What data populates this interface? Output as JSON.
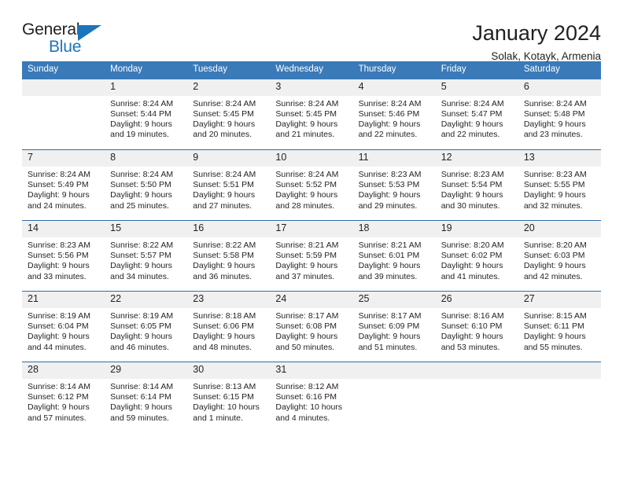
{
  "brand": {
    "name_dark": "General",
    "name_blue": "Blue",
    "triangle_icon": "blue-triangle-logo-mark",
    "accent_color": "#1b75bb"
  },
  "header": {
    "title": "January 2024",
    "subtitle": "Solak, Kotayk, Armenia"
  },
  "theme": {
    "header_row_background": "#3a7ab8",
    "header_row_text": "#ffffff",
    "daynum_background": "#f0f0f0",
    "row_divider": "#2f6ea8",
    "body_text": "#231f20"
  },
  "weekdays": [
    "Sunday",
    "Monday",
    "Tuesday",
    "Wednesday",
    "Thursday",
    "Friday",
    "Saturday"
  ],
  "weeks": [
    [
      {
        "day": "",
        "sunrise": "",
        "sunset": "",
        "daylight_1": "",
        "daylight_2": "",
        "empty": true
      },
      {
        "day": "1",
        "sunrise": "Sunrise: 8:24 AM",
        "sunset": "Sunset: 5:44 PM",
        "daylight_1": "Daylight: 9 hours",
        "daylight_2": "and 19 minutes."
      },
      {
        "day": "2",
        "sunrise": "Sunrise: 8:24 AM",
        "sunset": "Sunset: 5:45 PM",
        "daylight_1": "Daylight: 9 hours",
        "daylight_2": "and 20 minutes."
      },
      {
        "day": "3",
        "sunrise": "Sunrise: 8:24 AM",
        "sunset": "Sunset: 5:45 PM",
        "daylight_1": "Daylight: 9 hours",
        "daylight_2": "and 21 minutes."
      },
      {
        "day": "4",
        "sunrise": "Sunrise: 8:24 AM",
        "sunset": "Sunset: 5:46 PM",
        "daylight_1": "Daylight: 9 hours",
        "daylight_2": "and 22 minutes."
      },
      {
        "day": "5",
        "sunrise": "Sunrise: 8:24 AM",
        "sunset": "Sunset: 5:47 PM",
        "daylight_1": "Daylight: 9 hours",
        "daylight_2": "and 22 minutes."
      },
      {
        "day": "6",
        "sunrise": "Sunrise: 8:24 AM",
        "sunset": "Sunset: 5:48 PM",
        "daylight_1": "Daylight: 9 hours",
        "daylight_2": "and 23 minutes."
      }
    ],
    [
      {
        "day": "7",
        "sunrise": "Sunrise: 8:24 AM",
        "sunset": "Sunset: 5:49 PM",
        "daylight_1": "Daylight: 9 hours",
        "daylight_2": "and 24 minutes."
      },
      {
        "day": "8",
        "sunrise": "Sunrise: 8:24 AM",
        "sunset": "Sunset: 5:50 PM",
        "daylight_1": "Daylight: 9 hours",
        "daylight_2": "and 25 minutes."
      },
      {
        "day": "9",
        "sunrise": "Sunrise: 8:24 AM",
        "sunset": "Sunset: 5:51 PM",
        "daylight_1": "Daylight: 9 hours",
        "daylight_2": "and 27 minutes."
      },
      {
        "day": "10",
        "sunrise": "Sunrise: 8:24 AM",
        "sunset": "Sunset: 5:52 PM",
        "daylight_1": "Daylight: 9 hours",
        "daylight_2": "and 28 minutes."
      },
      {
        "day": "11",
        "sunrise": "Sunrise: 8:23 AM",
        "sunset": "Sunset: 5:53 PM",
        "daylight_1": "Daylight: 9 hours",
        "daylight_2": "and 29 minutes."
      },
      {
        "day": "12",
        "sunrise": "Sunrise: 8:23 AM",
        "sunset": "Sunset: 5:54 PM",
        "daylight_1": "Daylight: 9 hours",
        "daylight_2": "and 30 minutes."
      },
      {
        "day": "13",
        "sunrise": "Sunrise: 8:23 AM",
        "sunset": "Sunset: 5:55 PM",
        "daylight_1": "Daylight: 9 hours",
        "daylight_2": "and 32 minutes."
      }
    ],
    [
      {
        "day": "14",
        "sunrise": "Sunrise: 8:23 AM",
        "sunset": "Sunset: 5:56 PM",
        "daylight_1": "Daylight: 9 hours",
        "daylight_2": "and 33 minutes."
      },
      {
        "day": "15",
        "sunrise": "Sunrise: 8:22 AM",
        "sunset": "Sunset: 5:57 PM",
        "daylight_1": "Daylight: 9 hours",
        "daylight_2": "and 34 minutes."
      },
      {
        "day": "16",
        "sunrise": "Sunrise: 8:22 AM",
        "sunset": "Sunset: 5:58 PM",
        "daylight_1": "Daylight: 9 hours",
        "daylight_2": "and 36 minutes."
      },
      {
        "day": "17",
        "sunrise": "Sunrise: 8:21 AM",
        "sunset": "Sunset: 5:59 PM",
        "daylight_1": "Daylight: 9 hours",
        "daylight_2": "and 37 minutes."
      },
      {
        "day": "18",
        "sunrise": "Sunrise: 8:21 AM",
        "sunset": "Sunset: 6:01 PM",
        "daylight_1": "Daylight: 9 hours",
        "daylight_2": "and 39 minutes."
      },
      {
        "day": "19",
        "sunrise": "Sunrise: 8:20 AM",
        "sunset": "Sunset: 6:02 PM",
        "daylight_1": "Daylight: 9 hours",
        "daylight_2": "and 41 minutes."
      },
      {
        "day": "20",
        "sunrise": "Sunrise: 8:20 AM",
        "sunset": "Sunset: 6:03 PM",
        "daylight_1": "Daylight: 9 hours",
        "daylight_2": "and 42 minutes."
      }
    ],
    [
      {
        "day": "21",
        "sunrise": "Sunrise: 8:19 AM",
        "sunset": "Sunset: 6:04 PM",
        "daylight_1": "Daylight: 9 hours",
        "daylight_2": "and 44 minutes."
      },
      {
        "day": "22",
        "sunrise": "Sunrise: 8:19 AM",
        "sunset": "Sunset: 6:05 PM",
        "daylight_1": "Daylight: 9 hours",
        "daylight_2": "and 46 minutes."
      },
      {
        "day": "23",
        "sunrise": "Sunrise: 8:18 AM",
        "sunset": "Sunset: 6:06 PM",
        "daylight_1": "Daylight: 9 hours",
        "daylight_2": "and 48 minutes."
      },
      {
        "day": "24",
        "sunrise": "Sunrise: 8:17 AM",
        "sunset": "Sunset: 6:08 PM",
        "daylight_1": "Daylight: 9 hours",
        "daylight_2": "and 50 minutes."
      },
      {
        "day": "25",
        "sunrise": "Sunrise: 8:17 AM",
        "sunset": "Sunset: 6:09 PM",
        "daylight_1": "Daylight: 9 hours",
        "daylight_2": "and 51 minutes."
      },
      {
        "day": "26",
        "sunrise": "Sunrise: 8:16 AM",
        "sunset": "Sunset: 6:10 PM",
        "daylight_1": "Daylight: 9 hours",
        "daylight_2": "and 53 minutes."
      },
      {
        "day": "27",
        "sunrise": "Sunrise: 8:15 AM",
        "sunset": "Sunset: 6:11 PM",
        "daylight_1": "Daylight: 9 hours",
        "daylight_2": "and 55 minutes."
      }
    ],
    [
      {
        "day": "28",
        "sunrise": "Sunrise: 8:14 AM",
        "sunset": "Sunset: 6:12 PM",
        "daylight_1": "Daylight: 9 hours",
        "daylight_2": "and 57 minutes."
      },
      {
        "day": "29",
        "sunrise": "Sunrise: 8:14 AM",
        "sunset": "Sunset: 6:14 PM",
        "daylight_1": "Daylight: 9 hours",
        "daylight_2": "and 59 minutes."
      },
      {
        "day": "30",
        "sunrise": "Sunrise: 8:13 AM",
        "sunset": "Sunset: 6:15 PM",
        "daylight_1": "Daylight: 10 hours",
        "daylight_2": "and 1 minute."
      },
      {
        "day": "31",
        "sunrise": "Sunrise: 8:12 AM",
        "sunset": "Sunset: 6:16 PM",
        "daylight_1": "Daylight: 10 hours",
        "daylight_2": "and 4 minutes."
      },
      {
        "day": "",
        "sunrise": "",
        "sunset": "",
        "daylight_1": "",
        "daylight_2": "",
        "empty": true
      },
      {
        "day": "",
        "sunrise": "",
        "sunset": "",
        "daylight_1": "",
        "daylight_2": "",
        "empty": true
      },
      {
        "day": "",
        "sunrise": "",
        "sunset": "",
        "daylight_1": "",
        "daylight_2": "",
        "empty": true
      }
    ]
  ]
}
